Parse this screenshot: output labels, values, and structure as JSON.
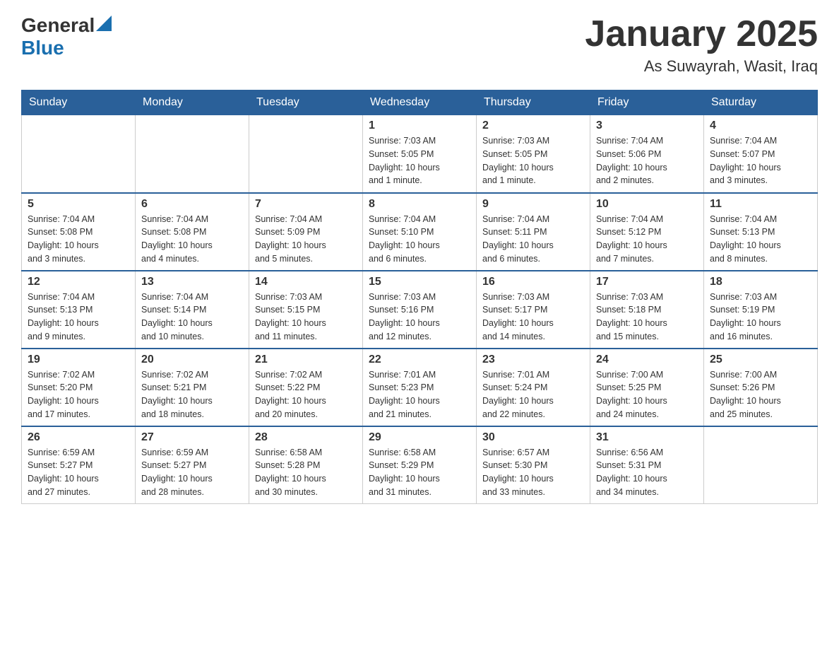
{
  "header": {
    "logo": {
      "general": "General",
      "arrow": "▶",
      "blue": "Blue"
    },
    "title": "January 2025",
    "location": "As Suwayrah, Wasit, Iraq"
  },
  "days_of_week": [
    "Sunday",
    "Monday",
    "Tuesday",
    "Wednesday",
    "Thursday",
    "Friday",
    "Saturday"
  ],
  "weeks": [
    [
      {
        "day": "",
        "info": ""
      },
      {
        "day": "",
        "info": ""
      },
      {
        "day": "",
        "info": ""
      },
      {
        "day": "1",
        "info": "Sunrise: 7:03 AM\nSunset: 5:05 PM\nDaylight: 10 hours\nand 1 minute."
      },
      {
        "day": "2",
        "info": "Sunrise: 7:03 AM\nSunset: 5:05 PM\nDaylight: 10 hours\nand 1 minute."
      },
      {
        "day": "3",
        "info": "Sunrise: 7:04 AM\nSunset: 5:06 PM\nDaylight: 10 hours\nand 2 minutes."
      },
      {
        "day": "4",
        "info": "Sunrise: 7:04 AM\nSunset: 5:07 PM\nDaylight: 10 hours\nand 3 minutes."
      }
    ],
    [
      {
        "day": "5",
        "info": "Sunrise: 7:04 AM\nSunset: 5:08 PM\nDaylight: 10 hours\nand 3 minutes."
      },
      {
        "day": "6",
        "info": "Sunrise: 7:04 AM\nSunset: 5:08 PM\nDaylight: 10 hours\nand 4 minutes."
      },
      {
        "day": "7",
        "info": "Sunrise: 7:04 AM\nSunset: 5:09 PM\nDaylight: 10 hours\nand 5 minutes."
      },
      {
        "day": "8",
        "info": "Sunrise: 7:04 AM\nSunset: 5:10 PM\nDaylight: 10 hours\nand 6 minutes."
      },
      {
        "day": "9",
        "info": "Sunrise: 7:04 AM\nSunset: 5:11 PM\nDaylight: 10 hours\nand 6 minutes."
      },
      {
        "day": "10",
        "info": "Sunrise: 7:04 AM\nSunset: 5:12 PM\nDaylight: 10 hours\nand 7 minutes."
      },
      {
        "day": "11",
        "info": "Sunrise: 7:04 AM\nSunset: 5:13 PM\nDaylight: 10 hours\nand 8 minutes."
      }
    ],
    [
      {
        "day": "12",
        "info": "Sunrise: 7:04 AM\nSunset: 5:13 PM\nDaylight: 10 hours\nand 9 minutes."
      },
      {
        "day": "13",
        "info": "Sunrise: 7:04 AM\nSunset: 5:14 PM\nDaylight: 10 hours\nand 10 minutes."
      },
      {
        "day": "14",
        "info": "Sunrise: 7:03 AM\nSunset: 5:15 PM\nDaylight: 10 hours\nand 11 minutes."
      },
      {
        "day": "15",
        "info": "Sunrise: 7:03 AM\nSunset: 5:16 PM\nDaylight: 10 hours\nand 12 minutes."
      },
      {
        "day": "16",
        "info": "Sunrise: 7:03 AM\nSunset: 5:17 PM\nDaylight: 10 hours\nand 14 minutes."
      },
      {
        "day": "17",
        "info": "Sunrise: 7:03 AM\nSunset: 5:18 PM\nDaylight: 10 hours\nand 15 minutes."
      },
      {
        "day": "18",
        "info": "Sunrise: 7:03 AM\nSunset: 5:19 PM\nDaylight: 10 hours\nand 16 minutes."
      }
    ],
    [
      {
        "day": "19",
        "info": "Sunrise: 7:02 AM\nSunset: 5:20 PM\nDaylight: 10 hours\nand 17 minutes."
      },
      {
        "day": "20",
        "info": "Sunrise: 7:02 AM\nSunset: 5:21 PM\nDaylight: 10 hours\nand 18 minutes."
      },
      {
        "day": "21",
        "info": "Sunrise: 7:02 AM\nSunset: 5:22 PM\nDaylight: 10 hours\nand 20 minutes."
      },
      {
        "day": "22",
        "info": "Sunrise: 7:01 AM\nSunset: 5:23 PM\nDaylight: 10 hours\nand 21 minutes."
      },
      {
        "day": "23",
        "info": "Sunrise: 7:01 AM\nSunset: 5:24 PM\nDaylight: 10 hours\nand 22 minutes."
      },
      {
        "day": "24",
        "info": "Sunrise: 7:00 AM\nSunset: 5:25 PM\nDaylight: 10 hours\nand 24 minutes."
      },
      {
        "day": "25",
        "info": "Sunrise: 7:00 AM\nSunset: 5:26 PM\nDaylight: 10 hours\nand 25 minutes."
      }
    ],
    [
      {
        "day": "26",
        "info": "Sunrise: 6:59 AM\nSunset: 5:27 PM\nDaylight: 10 hours\nand 27 minutes."
      },
      {
        "day": "27",
        "info": "Sunrise: 6:59 AM\nSunset: 5:27 PM\nDaylight: 10 hours\nand 28 minutes."
      },
      {
        "day": "28",
        "info": "Sunrise: 6:58 AM\nSunset: 5:28 PM\nDaylight: 10 hours\nand 30 minutes."
      },
      {
        "day": "29",
        "info": "Sunrise: 6:58 AM\nSunset: 5:29 PM\nDaylight: 10 hours\nand 31 minutes."
      },
      {
        "day": "30",
        "info": "Sunrise: 6:57 AM\nSunset: 5:30 PM\nDaylight: 10 hours\nand 33 minutes."
      },
      {
        "day": "31",
        "info": "Sunrise: 6:56 AM\nSunset: 5:31 PM\nDaylight: 10 hours\nand 34 minutes."
      },
      {
        "day": "",
        "info": ""
      }
    ]
  ]
}
